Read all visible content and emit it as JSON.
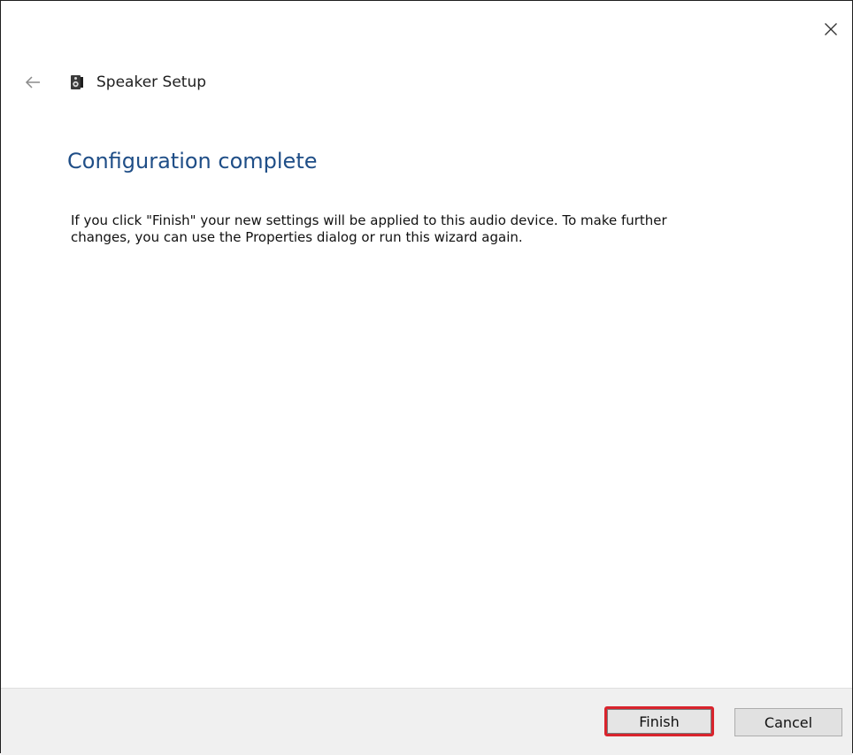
{
  "window": {
    "close_icon": "close-icon"
  },
  "nav": {
    "back_icon": "back-arrow-icon",
    "app_icon": "speaker-icon",
    "title": "Speaker Setup"
  },
  "content": {
    "heading": "Configuration complete",
    "body": "If you click \"Finish\" your new settings will be applied to this audio device.  To make further changes, you can use the Properties dialog or run this wizard again."
  },
  "footer": {
    "finish_label": "Finish",
    "cancel_label": "Cancel"
  },
  "colors": {
    "heading": "#1f4e87",
    "highlight": "#d9242d",
    "footer_bg": "#f0f0f0"
  }
}
